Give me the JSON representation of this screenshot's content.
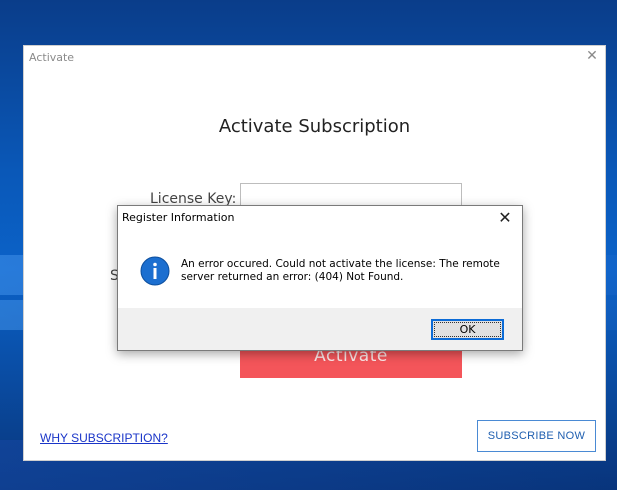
{
  "window": {
    "title": "Activate",
    "close_glyph": "✕"
  },
  "form": {
    "heading": "Activate Subscription",
    "license_label": "License Key:",
    "license_value": "",
    "partial_label": "S",
    "activate_label": "Activate"
  },
  "footer": {
    "why_link": "WHY SUBSCRIPTION?",
    "subscribe_label": "SUBSCRIBE NOW"
  },
  "dialog": {
    "title": "Register Information",
    "close_glyph": "✕",
    "icon": "info-icon",
    "message": "An error occured. Could not activate the license: The remote server returned an error: (404) Not Found.",
    "ok_label": "OK"
  },
  "colors": {
    "activate_button": "#f4555a",
    "info_icon": "#1c6fd0",
    "link": "#1a35c8",
    "subscribe_border": "#4a8ad4",
    "ok_border": "#0c6bd6"
  }
}
